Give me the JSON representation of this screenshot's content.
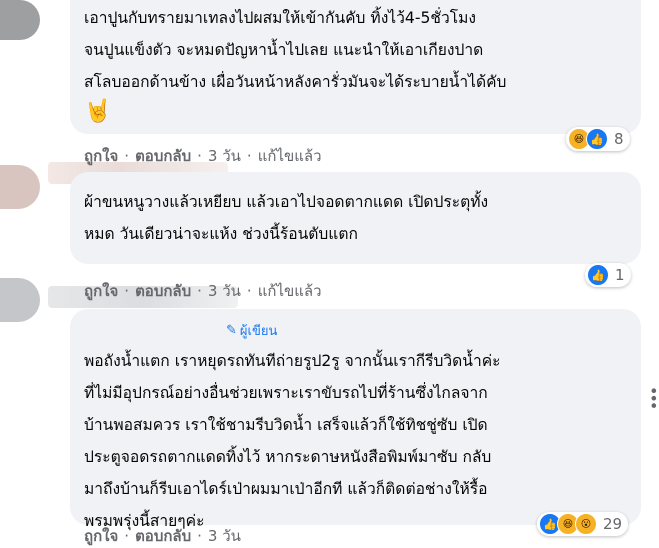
{
  "comments": [
    {
      "text": "เอาปูนกับทรายมาเทลงไปผสมให้เข้ากันคับ ทิ้งไว้4-5ชั่วโมง\nจนปูนแข็งตัว จะหมดปัญหาน้ำไปเลย แนะนำให้เอาเกียงปาด\nสโลบออกด้านข้าง เผื่อวันหน้าหลังคารั่วมันจะได้ระบายน้ำได้คับ",
      "emoji": "🤘",
      "reaction_count": "8",
      "like_label": "ถูกใจ",
      "reply_label": "ตอบกลับ",
      "time": "3 วัน",
      "edited": "แก้ไขแล้ว"
    },
    {
      "text": "ผ้าขนหนูวางแล้วเหยียบ แล้วเอาไปจอดตากแดด เปิดประตุทั้ง\nหมด วันเดียวน่าจะแห้ง ช่วงนี้ร้อนตับแตก",
      "reaction_count": "1",
      "like_label": "ถูกใจ",
      "reply_label": "ตอบกลับ",
      "time": "3 วัน",
      "edited": "แก้ไขแล้ว"
    },
    {
      "author_badge": "ผู้เขียน",
      "text": "พอถังน้ำแตก เราหยุดรถทันทีถ่ายรูป2รู จากนั้นเรากีรีบวิดน้ำค่ะ\nที่ไม่มีอุปกรณ์อย่างอื่นช่วยเพราะเราขับรถไปที่ร้านซึ่งไกลจาก\nบ้านพอสมควร เราใช้ชามรีบวิดน้ำ เสร็จแล้วก็ใช้ทิชชู่ซับ เปิด\nประตูจอดรถตากแดดทิ้งไว้ หากระดาษหนังสือพิมพ์มาซับ กลับ\nมาถึงบ้านก็รีบเอาไดร์เป่าผมมาเป่าอีกที แล้วก็ติดต่อช่างให้รื้อ\nพรมพรุ่งนี้สายๆค่ะ",
      "reaction_count": "29",
      "like_label": "ถูกใจ",
      "reply_label": "ตอบกลับ",
      "time": "3 วัน"
    }
  ],
  "separator": "·",
  "colors": {
    "bubble": "#f0f2f5",
    "link": "#1877f2",
    "meta": "#65676b"
  }
}
